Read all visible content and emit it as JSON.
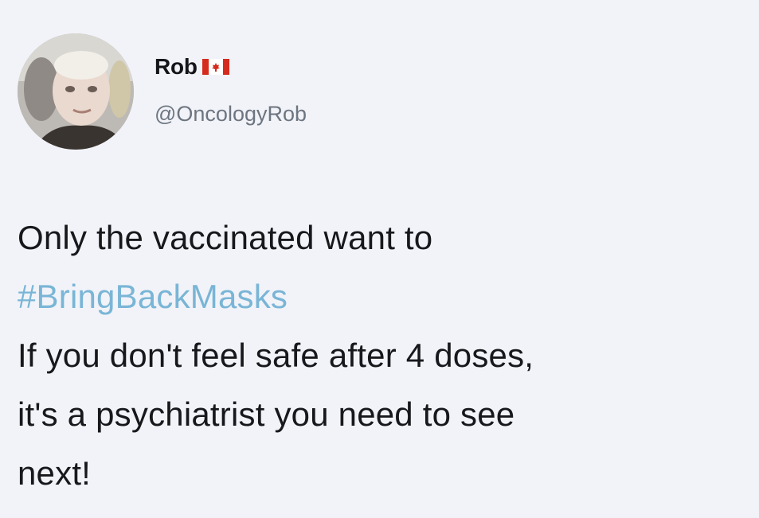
{
  "tweet": {
    "author": {
      "display_name": "Rob",
      "flag_icon": "canada-flag-icon",
      "handle": "@OncologyRob"
    },
    "lines": {
      "line1": "Only the vaccinated want to",
      "hashtag": "#BringBackMasks",
      "line3": "If you don't feel safe after 4 doses,",
      "line4": "it's a psychiatrist you need to see",
      "line5": "next!"
    }
  },
  "colors": {
    "background": "#f1f3f8",
    "text": "#17181b",
    "handle": "#6d7580",
    "hashtag": "#79b5d6",
    "flag_red": "#d52b1e"
  }
}
